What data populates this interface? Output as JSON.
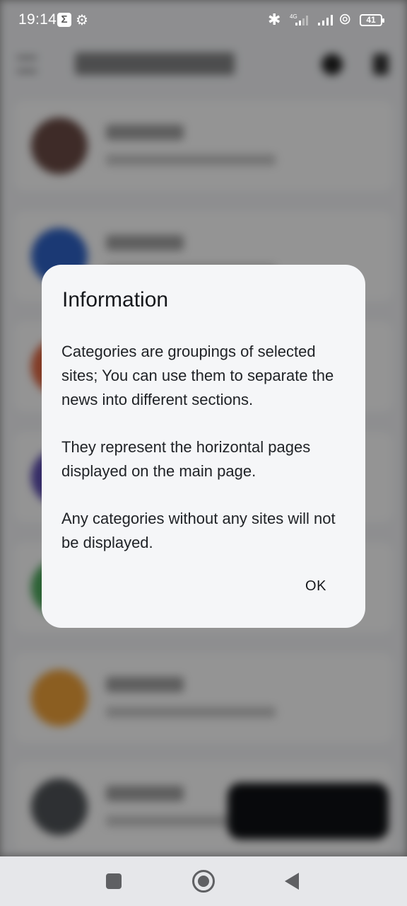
{
  "status_bar": {
    "time": "19:14",
    "sigma_glyph": "Σ",
    "gear_glyph": "⚙",
    "bluetooth_glyph": "✱",
    "network_label": "4G",
    "link_glyph": "⊚",
    "battery": "41"
  },
  "dialog": {
    "title": "Information",
    "paragraphs": [
      "Categories are groupings of selected sites; You can use them to separate the news into different sections.",
      "They represent the horizontal pages displayed on the main page.",
      "Any categories without any sites will not be displayed."
    ],
    "ok_label": "OK"
  },
  "background": {
    "avatar_colors": [
      "#6b4b45",
      "#2f63c8",
      "#e0653f",
      "#5a4ab0",
      "#4aa85a",
      "#f0a23a",
      "#505458"
    ]
  }
}
